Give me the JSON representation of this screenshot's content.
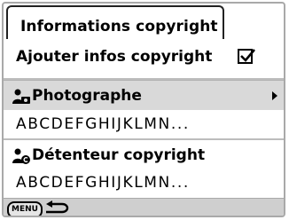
{
  "header": {
    "title": "Informations copyright"
  },
  "toggle": {
    "label": "Ajouter infos copyright",
    "checked": true
  },
  "photographer": {
    "label": "Photographe",
    "value": "ABCDEFGHIJKLMN..."
  },
  "holder": {
    "label": "Détenteur copyright",
    "value": "ABCDEFGHIJKLMN..."
  },
  "footer": {
    "menu_label": "MENU"
  }
}
